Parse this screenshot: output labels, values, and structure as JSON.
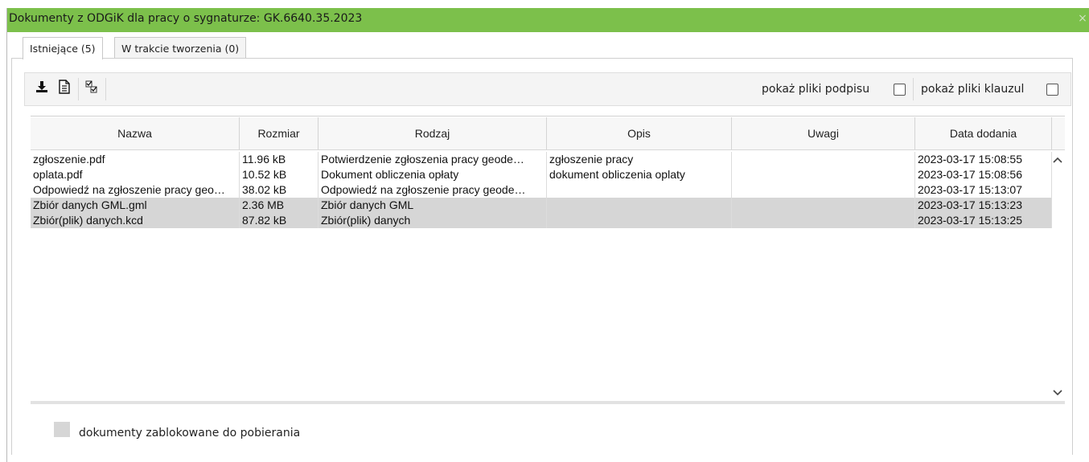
{
  "window": {
    "title": "Dokumenty z ODGiK dla pracy o sygnaturze: GK.6640.35.2023",
    "close_symbol": "×",
    "accent_color": "#7cc04b"
  },
  "tabs": [
    {
      "label": "Istniejące (5)",
      "active": true
    },
    {
      "label": "W trakcie tworzenia (0)",
      "active": false
    }
  ],
  "toolbar": {
    "buttons": [
      {
        "icon": "download-icon"
      },
      {
        "icon": "document-icon"
      },
      {
        "icon": "checklist-icon"
      }
    ],
    "show_signature_files_label": "pokaż pliki podpisu",
    "show_signature_files_checked": false,
    "show_clause_files_label": "pokaż pliki klauzul",
    "show_clause_files_checked": false
  },
  "table": {
    "columns": [
      "Nazwa",
      "Rozmiar",
      "Rodzaj",
      "Opis",
      "Uwagi",
      "Data dodania"
    ],
    "rows": [
      {
        "name": "zgłoszenie.pdf",
        "size": "11.96 kB",
        "type": "Potwierdzenie zgłoszenia pracy geode…",
        "description": "zgłoszenie pracy",
        "notes": "",
        "added": "2023-03-17 15:08:55",
        "locked": false
      },
      {
        "name": "oplata.pdf",
        "size": "10.52 kB",
        "type": "Dokument obliczenia opłaty",
        "description": "dokument obliczenia oplaty",
        "notes": "",
        "added": "2023-03-17 15:08:56",
        "locked": false
      },
      {
        "name": "Odpowiedź na zgłoszenie pracy geo…",
        "size": "38.02 kB",
        "type": "Odpowiedź na zgłoszenie pracy geode…",
        "description": "",
        "notes": "",
        "added": "2023-03-17 15:13:07",
        "locked": false
      },
      {
        "name": "Zbiór danych GML.gml",
        "size": "2.36 MB",
        "type": "Zbiór danych GML",
        "description": "",
        "notes": "",
        "added": "2023-03-17 15:13:23",
        "locked": true
      },
      {
        "name": "Zbiór(plik) danych.kcd",
        "size": "87.82 kB",
        "type": "Zbiór(plik) danych",
        "description": "",
        "notes": "",
        "added": "2023-03-17 15:13:25",
        "locked": true
      }
    ],
    "locked_row_color": "#d6d6d6"
  },
  "legend": {
    "locked_label": "dokumenty zablokowane do pobierania"
  }
}
